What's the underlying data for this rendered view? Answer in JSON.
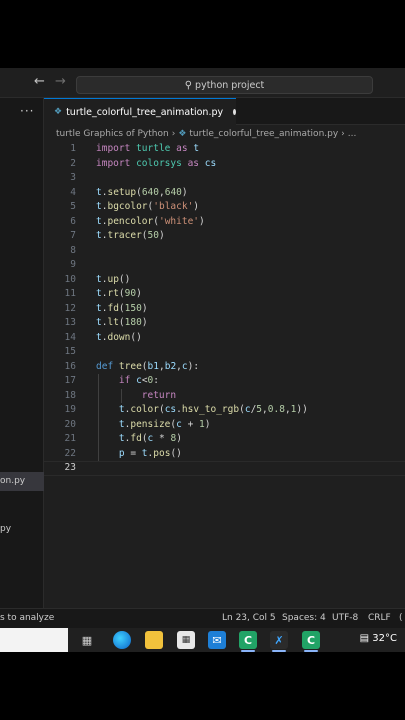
{
  "titlebar": {
    "search_text": "python project"
  },
  "sidebar": {
    "more_label": "···",
    "selected_file_fragment": "on.py",
    "py_fragment": "py"
  },
  "tab": {
    "label": "turtle_colorful_tree_animation.py"
  },
  "breadcrumb": {
    "folder": "turtle Graphics of Python",
    "file": "turtle_colorful_tree_animation.py",
    "more": "..."
  },
  "editor": {
    "current_line": 23,
    "lines": [
      "import turtle as t",
      "import colorsys as cs",
      "",
      "t.setup(640,640)",
      "t.bgcolor('black')",
      "t.pencolor('white')",
      "t.tracer(50)",
      "",
      "",
      "t.up()",
      "t.rt(90)",
      "t.fd(150)",
      "t.lt(180)",
      "t.down()",
      "",
      "def tree(b1,b2,c):",
      "    if c<0:",
      "        return",
      "    t.color(cs.hsv_to_rgb(c/5,0.8,1))",
      "    t.pensize(c + 1)",
      "    t.fd(c * 8)",
      "    p = t.pos()",
      ""
    ]
  },
  "statusbar": {
    "left": "s to analyze",
    "position": "Ln 23, Col 5",
    "spaces": "Spaces: 4",
    "encoding": "UTF-8",
    "eol": "CRLF",
    "paren": "("
  },
  "taskbar": {
    "temperature": "32°C"
  }
}
